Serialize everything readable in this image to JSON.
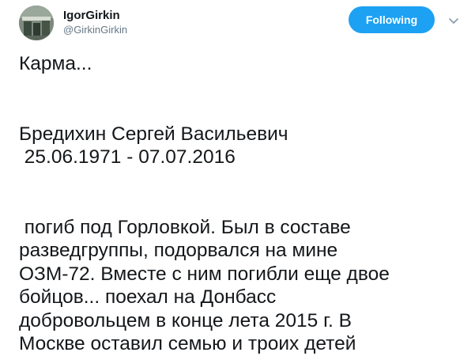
{
  "author": {
    "display_name": "IgorGirkin",
    "handle": "@GirkinGirkin"
  },
  "actions": {
    "follow_label": "Following"
  },
  "icons": {
    "menu": "chevron-down-icon"
  },
  "colors": {
    "accent": "#1da1f2",
    "text": "#14171a",
    "muted": "#657786"
  },
  "tweet": {
    "lines": [
      "Карма...",
      "",
      "",
      "Бредихин Сергей Васильевич",
      " 25.06.1971 - 07.07.2016",
      "",
      "",
      " погиб под Горловкой. Был в составе",
      "разведгруппы, подорвался на мине",
      "ОЗМ-72. Вместе с ним погибли еще двое",
      "бойцов... поехал на Донбасс",
      "добровольцем в конце лета 2015 г. В",
      "Москве оставил семью и троих детей"
    ]
  }
}
